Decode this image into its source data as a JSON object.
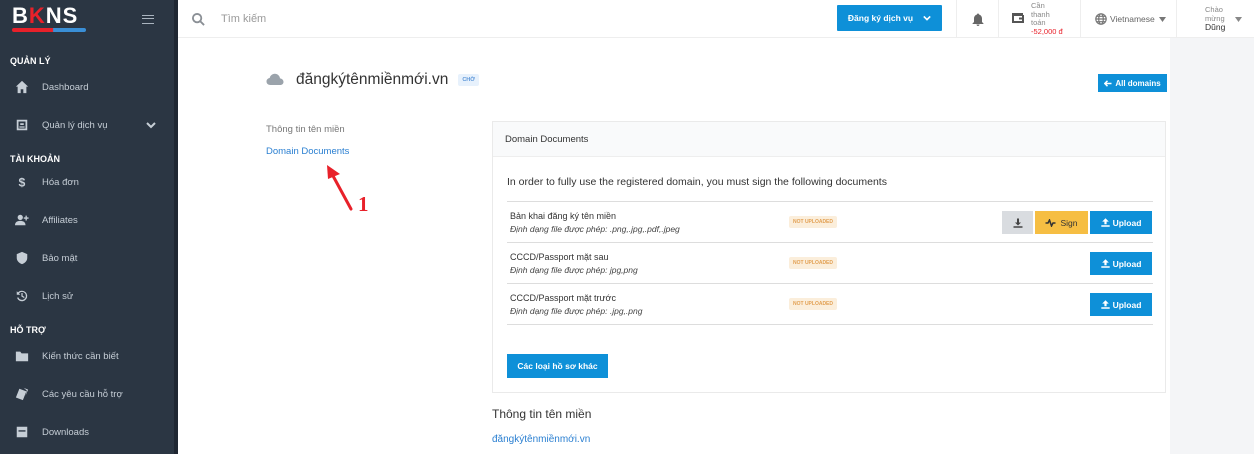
{
  "brand": {
    "logo_prefix": "B",
    "logo_k": "K",
    "logo_suffix": "NS"
  },
  "sidebar": {
    "sections": [
      {
        "title": "QUẢN LÝ",
        "items": [
          {
            "label": "Dashboard",
            "icon": "home-icon"
          },
          {
            "label": "Quản lý dịch vụ",
            "icon": "services-icon"
          }
        ]
      },
      {
        "title": "TÀI KHOẢN",
        "items": [
          {
            "label": "Hóa đơn",
            "icon": "dollar-icon"
          },
          {
            "label": "Affiliates",
            "icon": "user-plus-icon"
          },
          {
            "label": "Bảo mật",
            "icon": "shield-icon"
          },
          {
            "label": "Lịch sử",
            "icon": "history-icon"
          }
        ]
      },
      {
        "title": "HỖ TRỢ",
        "items": [
          {
            "label": "Kiến thức cần biết",
            "icon": "folder-icon"
          },
          {
            "label": "Các yêu cầu hỗ trợ",
            "icon": "tickets-icon"
          },
          {
            "label": "Downloads",
            "icon": "download-box-icon"
          }
        ]
      }
    ]
  },
  "topbar": {
    "search_placeholder": "Tìm kiếm",
    "register_button": "Đăng ký dịch vụ",
    "wallet_line1": "Cần",
    "wallet_line2": "thanh",
    "wallet_line3": "toán",
    "wallet_amount": "-52,000 đ",
    "language": "Vietnamese",
    "greeting_line1": "Chào",
    "greeting_line2": "mừng",
    "user_name": "Dũng"
  },
  "domain": {
    "name": "đăngkýtênmiềnmới.vn",
    "status": "CHỜ",
    "all_domains_label": "All domains"
  },
  "side_links": {
    "info": "Thông tin tên miền",
    "documents": "Domain Documents"
  },
  "annotation": {
    "number": "1",
    "color": "#e8212a"
  },
  "documents_card": {
    "title": "Domain Documents",
    "intro": "In order to fully use the registered domain, you must sign the following documents",
    "rows": [
      {
        "name": "Bản khai đăng ký tên miền",
        "formats": "Định dạng file được phép: .png,.jpg,.pdf,.jpeg",
        "status": "NOT UPLOADED",
        "sign_label": "Sign",
        "upload_label": "Upload"
      },
      {
        "name": "CCCD/Passport mặt sau",
        "formats": "Định dạng file được phép: jpg,png",
        "status": "NOT UPLOADED",
        "upload_label": "Upload"
      },
      {
        "name": "CCCD/Passport mặt trước",
        "formats": "Định dạng file được phép: .jpg,.png",
        "status": "NOT UPLOADED",
        "upload_label": "Upload"
      }
    ],
    "other_docs_button": "Các loại hồ sơ khác"
  },
  "domain_info": {
    "title": "Thông tin tên miền",
    "link": "đăngkýtênmiềnmới.vn"
  },
  "colors": {
    "accent": "#0e90d8",
    "sidebar_bg": "#2b3643",
    "sign": "#f6be43",
    "badge_bg": "#fbeedb",
    "badge_text": "#e2a053"
  }
}
